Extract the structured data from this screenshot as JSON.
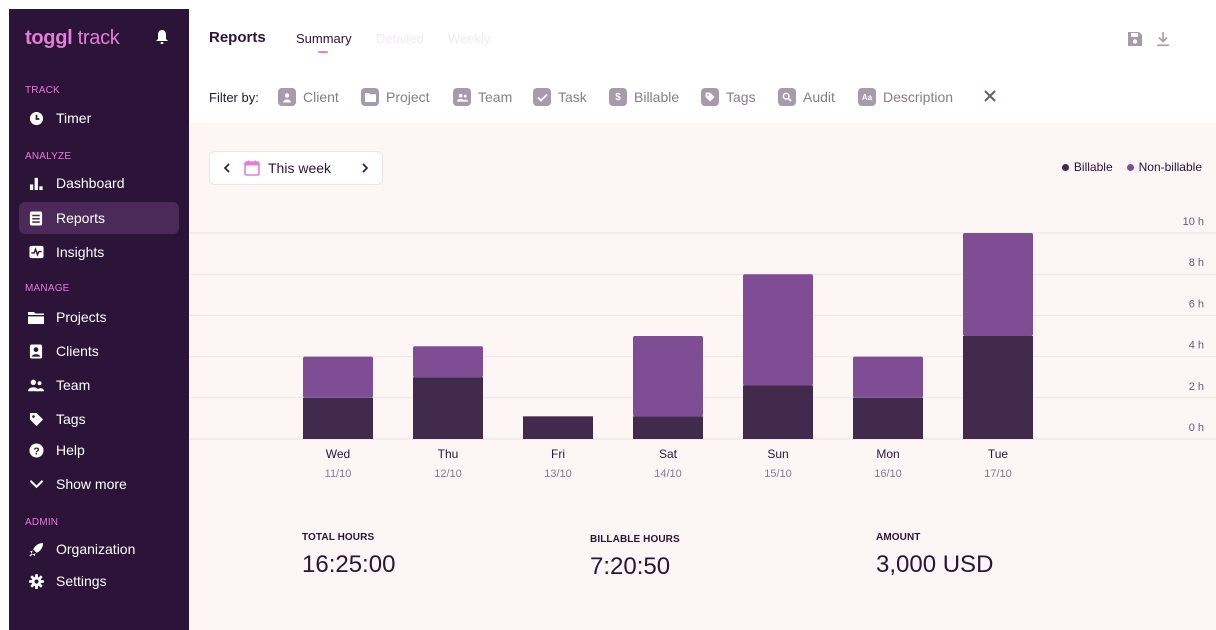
{
  "brand": {
    "logo_bold": "toggl",
    "logo_rest": " track"
  },
  "sidebar": {
    "sections": {
      "track": "TRACK",
      "analyze": "ANALYZE",
      "manage": "MANAGE",
      "admin": "ADMIN"
    },
    "items": {
      "timer": "Timer",
      "dashboard": "Dashboard",
      "reports": "Reports",
      "insights": "Insights",
      "projects": "Projects",
      "clients": "Clients",
      "team": "Team",
      "tags": "Tags",
      "help": "Help",
      "show_more": "Show more",
      "organization": "Organization",
      "settings": "Settings"
    },
    "active_item": "Reports"
  },
  "header": {
    "title": "Reports",
    "tabs": {
      "summary": "Summary",
      "detailed": "Detailed",
      "weekly": "Weekly"
    },
    "active_tab": "Summary"
  },
  "filters": {
    "label": "Filter by:",
    "items": {
      "client": "Client",
      "project": "Project",
      "team": "Team",
      "task": "Task",
      "billable": "Billable",
      "tags": "Tags",
      "audit": "Audit",
      "description": "Description"
    }
  },
  "date_range": {
    "label": "This week"
  },
  "legend": {
    "billable": "Billable",
    "non_billable": "Non-billable"
  },
  "colors": {
    "sidebar_bg": "#2c1338",
    "accent_pink": "#e57cd8",
    "billable": "#412a4c",
    "non_billable": "#7f4d93",
    "main_bg": "#fdf6f5"
  },
  "chart_data": {
    "type": "bar",
    "stacked": true,
    "categories": [
      "Wed",
      "Thu",
      "Fri",
      "Sat",
      "Sun",
      "Mon",
      "Tue"
    ],
    "dates": [
      "11/10",
      "12/10",
      "13/10",
      "14/10",
      "15/10",
      "16/10",
      "17/10"
    ],
    "series": [
      {
        "name": "Billable",
        "values": [
          2.0,
          3.0,
          1.1,
          1.1,
          2.6,
          2.0,
          5.0
        ]
      },
      {
        "name": "Non-billable",
        "values": [
          2.0,
          1.5,
          0.0,
          3.9,
          5.4,
          2.0,
          5.0
        ]
      }
    ],
    "y_ticks": [
      "0 h",
      "2 h",
      "4 h",
      "6 h",
      "8 h",
      "10 h"
    ],
    "ylim": [
      0,
      10
    ],
    "grid": true,
    "legend_position": "top-right"
  },
  "stats": {
    "total_hours": {
      "label": "TOTAL HOURS",
      "value": "16:25:00"
    },
    "billable_hours": {
      "label": "BILLABLE HOURS",
      "value": "7:20:50"
    },
    "amount": {
      "label": "AMOUNT",
      "value": "3,000 USD"
    }
  }
}
